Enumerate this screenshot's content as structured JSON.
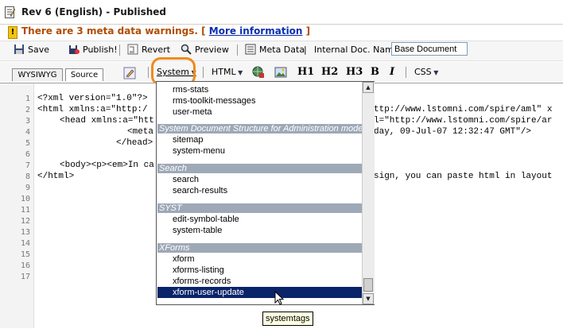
{
  "window": {
    "title": "Rev 6 (English) - Published"
  },
  "warning": {
    "text": "There are 3 meta data warnings. [",
    "link": "More information",
    "close": "]"
  },
  "toolbar": {
    "save": "Save",
    "publish": "Publish!",
    "revert": "Revert",
    "preview": "Preview",
    "metadata": "Meta Data",
    "separator": "|",
    "docname_label": "Internal Doc. Name:",
    "docname_value": "Base Document"
  },
  "editor_toolbar": {
    "tab_wysiwyg": "WYSIWYG",
    "tab_source": "Source",
    "system": "System",
    "html": "HTML",
    "h1": "H1",
    "h2": "H2",
    "h3": "H3",
    "bold": "B",
    "italic": "I",
    "css": "CSS"
  },
  "line_numbers": [
    "1",
    "2",
    "3",
    "4",
    "5",
    "6",
    "7",
    "8",
    "9",
    "10",
    "11",
    "12",
    "13",
    "14",
    "15",
    "16",
    "17"
  ],
  "code_left": [
    "<?xml version=\"1.0\"?>",
    "<html xmlns:a=\"http:/",
    "<head xmlns:a=\"htt",
    "<meta",
    "</head>",
    "",
    "<body><p><em>In ca",
    "</html>"
  ],
  "code_right": [
    "ttp://www.lstomni.com/spire/aml\" x",
    "l=\"http://www.lstomni.com/spire/ar",
    "day, 09-Jul-07 12:32:47 GMT\"/>",
    "sign, you can paste html in layout"
  ],
  "dropdown": {
    "top_items": [
      "rms-stats",
      "rms-toolkit-messages",
      "user-meta"
    ],
    "groups": [
      {
        "label": "System Document Structure for Administration mode",
        "items": [
          "sitemap",
          "system-menu"
        ]
      },
      {
        "label": "Search",
        "items": [
          "search",
          "search-results"
        ]
      },
      {
        "label": "SYST",
        "items": [
          "edit-symbol-table",
          "system-table"
        ]
      },
      {
        "label": "XForms",
        "items": [
          "xform",
          "xforms-listing",
          "xforms-records"
        ]
      }
    ],
    "selected": "xform-user-update"
  },
  "tooltip": "systemtags",
  "colors": {
    "accent_ring": "#f08a1c",
    "selection": "#0a246a",
    "group_header": "#9ea9b7",
    "warning_text": "#b14c00"
  }
}
